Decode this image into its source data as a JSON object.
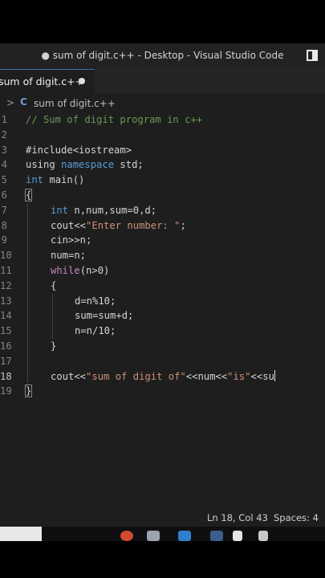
{
  "window": {
    "title": "● sum of digit.c++ - Desktop - Visual Studio Code"
  },
  "tab": {
    "label": "sum of digit.c++"
  },
  "breadcrumb": {
    "separator": ">",
    "file": "sum of digit.c++",
    "icon": "c-icon"
  },
  "code": {
    "line_numbers": [
      "1",
      "2",
      "3",
      "4",
      "5",
      "6",
      "7",
      "8",
      "9",
      "10",
      "11",
      "12",
      "13",
      "14",
      "15",
      "16",
      "17",
      "18",
      "19"
    ],
    "lines": [
      "// Sum of digit program in c++",
      "",
      "#include<iostream>",
      "using namespace std;",
      "int main()",
      "{",
      "int n,num,sum=0,d;",
      "cout<<\"Enter number: \";",
      "cin>>n;",
      "num=n;",
      "while(n>0)",
      "{",
      "d=n%10;",
      "sum=sum+d;",
      "n=n/10;",
      "}",
      "",
      "cout<<\"sum of digit of\"<<num<<\"is\"<<su",
      "}"
    ]
  },
  "status": {
    "position": "Ln 18, Col 43",
    "spaces": "Spaces: 4"
  }
}
